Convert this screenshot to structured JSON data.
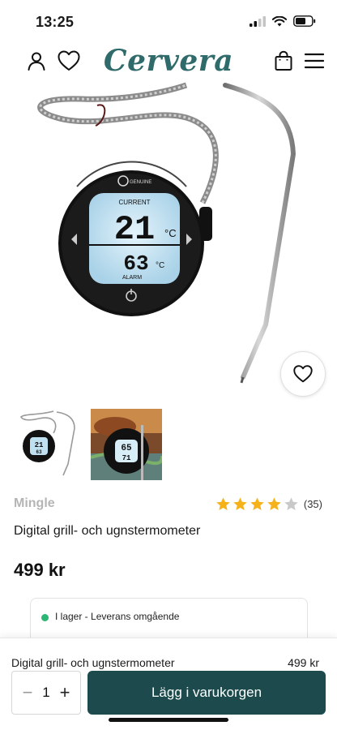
{
  "status": {
    "time": "13:25"
  },
  "header": {
    "logo": "Cervera"
  },
  "hero_display": {
    "label_top": "CURRENT",
    "current_temp": "21",
    "unit": "°C",
    "alarm_temp": "63",
    "label_bottom": "ALARM"
  },
  "thumb_display": {
    "top": "65",
    "bottom": "71"
  },
  "product": {
    "brand": "Mingle",
    "rating": 4,
    "rating_max": 5,
    "review_count": "(35)",
    "title": "Digital grill- och ugnstermometer",
    "price": "499 kr",
    "stock": "I lager - Leverans omgående"
  },
  "sticky": {
    "title": "Digital grill- och ugnstermometer",
    "price": "499 kr",
    "qty_minus": "−",
    "qty_value": "1",
    "qty_plus": "+",
    "cta": "Lägg i varukorgen"
  },
  "colors": {
    "brand": "#2f6b6a",
    "cta": "#1d4a4c",
    "star": "#f5b21b",
    "stock": "#2bb673"
  }
}
